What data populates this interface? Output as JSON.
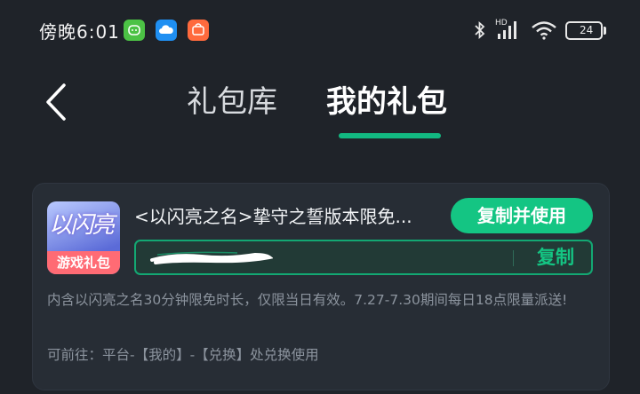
{
  "status_bar": {
    "time": "傍晚6:01",
    "network_label": "HD",
    "battery_level": "24"
  },
  "header": {
    "tabs": [
      {
        "label": "礼包库",
        "active": false
      },
      {
        "label": "我的礼包",
        "active": true
      }
    ]
  },
  "gift": {
    "thumbnail_title": "以闪亮",
    "thumbnail_banner": "游戏礼包",
    "title": "<以闪亮之名>挚守之誓版本限免...",
    "copy_and_use_label": "复制并使用",
    "copy_label": "复制",
    "description": "内含以闪亮之名30分钟限免时长，仅限当日有效。7.27-7.30期间每日18点限量派送!",
    "redeem_hint": "可前往：平台-【我的】-【兑换】处兑换使用"
  },
  "colors": {
    "accent": "#14c583",
    "background": "#1f2329",
    "card": "#272d35"
  }
}
